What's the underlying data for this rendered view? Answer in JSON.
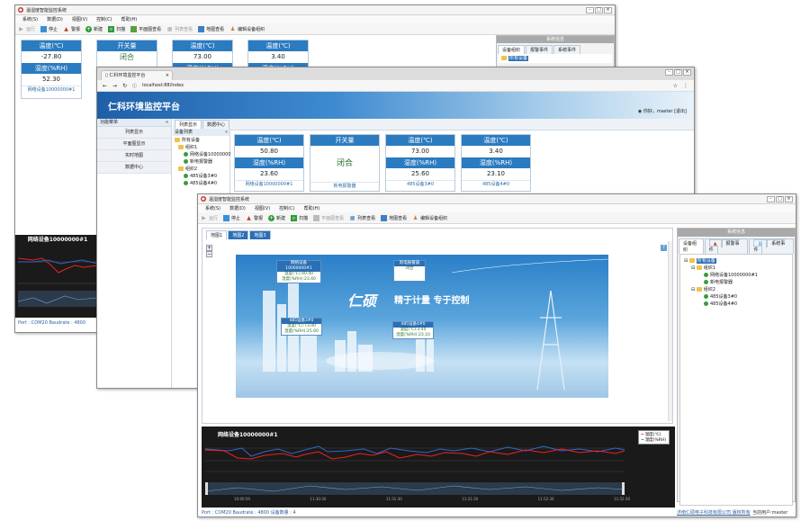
{
  "win1": {
    "title": "温湿度智能监控系统",
    "menu": [
      "系统(S)",
      "数据(D)",
      "视图(V)",
      "控制(C)",
      "帮助(H)"
    ],
    "toolbar": [
      "运行",
      "停止",
      "警报",
      "新建",
      "扫描",
      "平面图查看",
      "列表查看",
      "地图查看",
      "编辑设备组织"
    ],
    "cards": [
      {
        "h1": "温度(℃)",
        "v1": "-27.80",
        "h2": "湿度(%RH)",
        "v2": "52.30",
        "f": "网络设备10000000#1"
      },
      {
        "h1": "开关量",
        "v1": "闭合"
      },
      {
        "h1": "温度(℃)",
        "v1": "73.00",
        "h2": "湿度(%RH)"
      },
      {
        "h1": "温度(℃)",
        "v1": "3.40",
        "h2": "湿度(%RH)"
      }
    ],
    "panel_title": "系统信息",
    "panel_tabs": [
      "设备组织",
      "报警事件",
      "系统事件"
    ],
    "tree_root": "所有设备",
    "chart_title": "网络设备10000000#1",
    "status": "Port : COM20     Baudrate : 4800"
  },
  "win2": {
    "tab": "仁科环境监控平台",
    "url": "localhost:88/Index",
    "brand": "仁科环境监控平台",
    "user": "你好，master",
    "logout": "[退出]",
    "menu_title": "功能菜单",
    "menu": [
      "列表显示",
      "平面图显示",
      "实时地图",
      "数据中心"
    ],
    "tabs": [
      "列表显示",
      "数据中心"
    ],
    "dev_list": "设备列表",
    "tree": [
      "所有设备",
      "组织1",
      "网络设备10000000",
      "新电报警器",
      "组织2",
      "485设备3#0",
      "485设备4#0"
    ],
    "cards": [
      {
        "h1": "温度(℃)",
        "v1": "50.80",
        "h2": "湿度(%RH)",
        "v2": "23.60",
        "f": "网络设备10000000#1"
      },
      {
        "h1": "开关量",
        "v1": "闭合",
        "f": "新电报警器"
      },
      {
        "h1": "温度(℃)",
        "v1": "73.00",
        "h2": "湿度(%RH)",
        "v2": "25.60",
        "f": "485设备3#0"
      },
      {
        "h1": "温度(℃)",
        "v1": "3.40",
        "h2": "湿度(%RH)",
        "v2": "23.10",
        "f": "485设备4#0"
      }
    ]
  },
  "win3": {
    "title": "温湿度智能监控系统",
    "menu": [
      "系统(S)",
      "数据(D)",
      "视图(V)",
      "控制(C)",
      "帮助(H)"
    ],
    "toolbar": [
      "运行",
      "停止",
      "警报",
      "新建",
      "扫描",
      "平面图查看",
      "列表查看",
      "地图查看",
      "编辑设备组织"
    ],
    "map_tabs": [
      "地图1",
      "地图2",
      "地图3"
    ],
    "banner_logo": "仁硕",
    "banner_slogan": "精于计量 专于控制",
    "boxes": [
      {
        "h": "网络设备10000000#1",
        "l1": "温度(℃):40.40",
        "l2": "湿度(%RH):23.40"
      },
      {
        "h": "新电报警器",
        "l1": "闭合"
      },
      {
        "h": "485设备3#0",
        "l1": "温度(℃):73.00",
        "l2": "湿度(%RH):25.60"
      },
      {
        "h": "485设备4#0",
        "l1": "温度(℃):3.40",
        "l2": "湿度(%RH):23.10"
      }
    ],
    "panel_title": "系统信息",
    "panel_tabs": [
      "设备组织",
      "报警事件",
      "系统事件"
    ],
    "tree": [
      "所有设备",
      "组织1",
      "网络设备10000000#1",
      "新电报警器",
      "组织2",
      "485设备3#0",
      "485设备4#0"
    ],
    "chart_title": "网络设备10000000#1",
    "legend": [
      "温度(℃)",
      "湿度(%RH)"
    ],
    "times": [
      "10:00:59",
      "11:30:30",
      "11:31:30",
      "11:31:30",
      "11:52:30",
      "11:52:30"
    ],
    "status_left": "Port : COM20     Baudrate : 4800     设备数量 : 4",
    "status_company": "济南仁硕电子科技有限公司 版权所有",
    "status_user": "当前用户:master"
  }
}
